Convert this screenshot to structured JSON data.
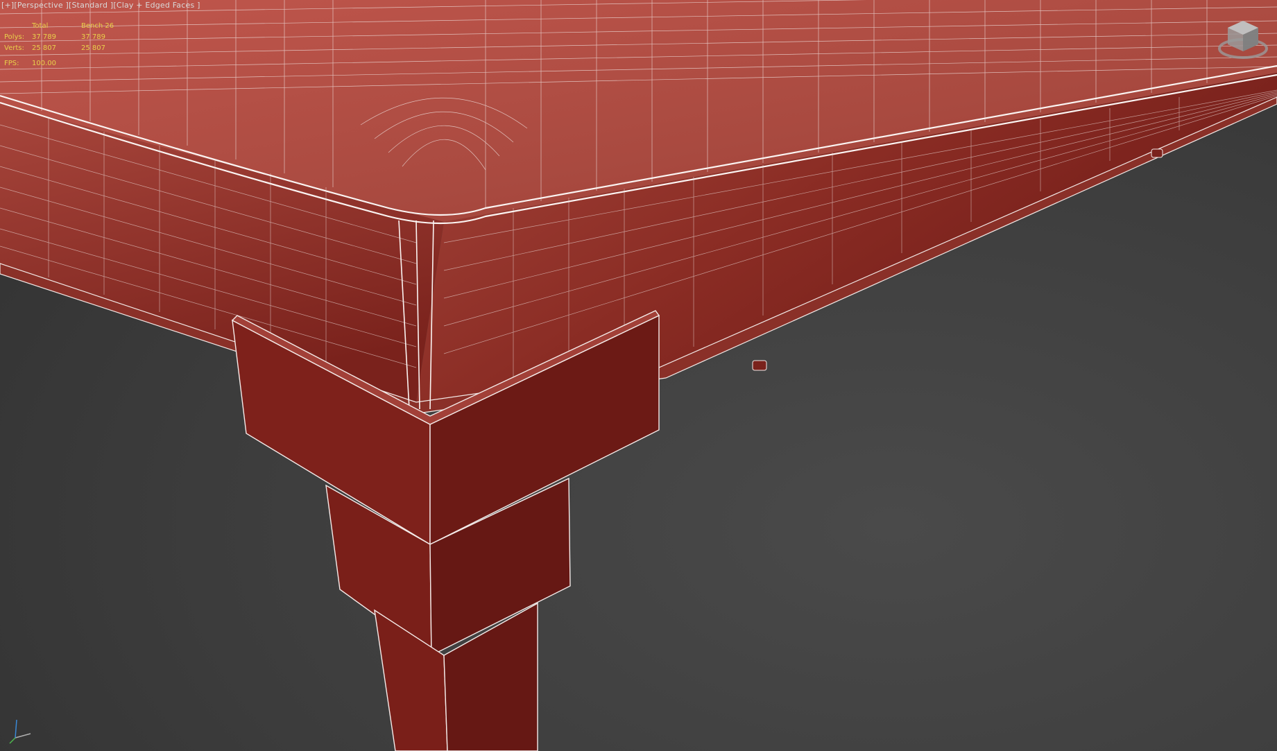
{
  "viewport": {
    "label_parts": [
      "[+]",
      "[Perspective ]",
      "[Standard ]",
      "[Clay + Edged Faces ]"
    ]
  },
  "stats": {
    "headers": [
      "",
      "Total",
      "Bench 26"
    ],
    "rows": [
      {
        "label": "Polys:",
        "total": "37 789",
        "object": "37 789"
      },
      {
        "label": "Verts:",
        "total": "25 807",
        "object": "25 807"
      }
    ],
    "fps_label": "FPS:",
    "fps_value": "100.00"
  },
  "colors": {
    "clay": "#8e2a24",
    "clay_light": "#b8544a",
    "clay_dark": "#6a1a16",
    "wire": "#f0e6e4",
    "background": "#3d3d3d",
    "stats_text": "#e8d04a"
  },
  "icons": {
    "viewcube": "viewcube-icon",
    "axis": "axis-tripod-icon"
  }
}
